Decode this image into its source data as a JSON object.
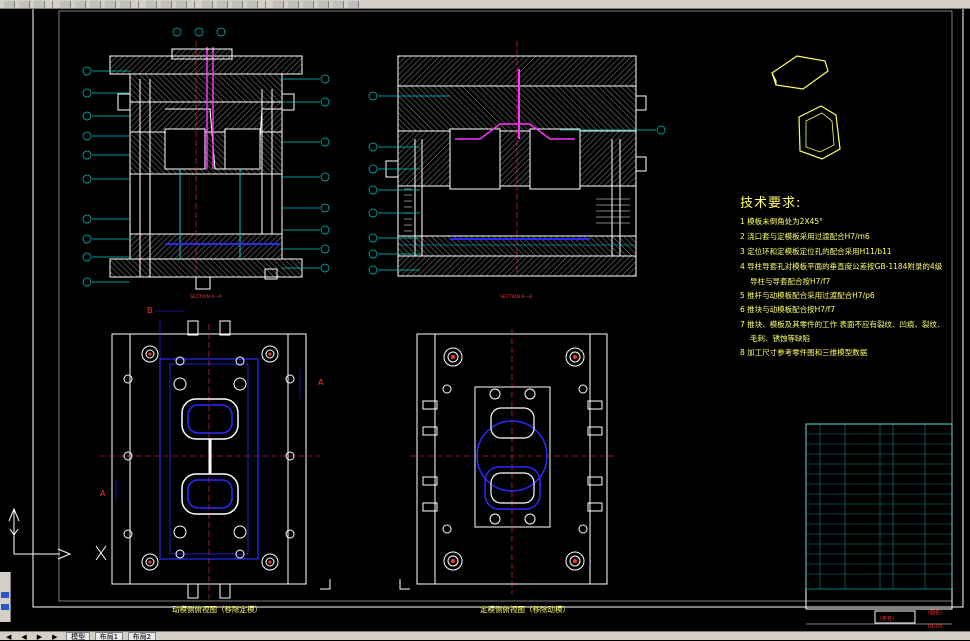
{
  "toolbar": {
    "buttons": [
      "new",
      "open",
      "save",
      "print",
      "preview",
      "cut",
      "copy",
      "paste",
      "match",
      "undo",
      "redo",
      "pan",
      "zoom-realtime",
      "zoom-window",
      "zoom-previous",
      "properties",
      "design-center",
      "tool-palettes",
      "markup",
      "calc",
      "help"
    ]
  },
  "drawing": {
    "section_aa_label": "SECTION A—A",
    "section_bb_label": "SECTION B—B",
    "left_plan_caption": "动模侧俯视图（移除定模）",
    "right_plan_caption": "定模侧俯视图（移除动模）",
    "cut_letter_a": "A",
    "cut_letter_b": "B"
  },
  "tech": {
    "title": "技术要求:",
    "items": [
      {
        "num": "1",
        "text": "模板未倒角处为2X45°"
      },
      {
        "num": "2",
        "text": "浇口套与定模板采用过渡配合H7/m6"
      },
      {
        "num": "3",
        "text": "定位环和定模板定位孔的配合采用H11/b11"
      },
      {
        "num": "4",
        "text": "导柱导套孔对模板平面的垂直度公差按GB-1184附录的4级"
      },
      {
        "num": "",
        "text": "导柱与导套配合按H7/f7"
      },
      {
        "num": "5",
        "text": "推杆与动模板配合采用过渡配合H7/p6"
      },
      {
        "num": "6",
        "text": "推块与动模板配合按H7/f7"
      },
      {
        "num": "7",
        "text": "推块、模板及其零件的工作 表面不应有裂纹、凹痕、裂纹、"
      },
      {
        "num": "",
        "text": "毛刺、锈蚀等缺陷"
      },
      {
        "num": "8",
        "text": "加工尺寸参考零件图和三维模型数据"
      }
    ]
  },
  "title_block": {
    "school_label": "(校名)",
    "drawing_label": "(图名)",
    "code_label": "01-00"
  },
  "tabs": {
    "nav": [
      "◀",
      "◀",
      "▶",
      "▶"
    ],
    "items": [
      "模型",
      "布局1",
      "布局2"
    ]
  },
  "colors": {
    "background": "#000000",
    "outline": "#ffffff",
    "hatch": "#cfcfcf",
    "accent_blue": "#2a2aff",
    "accent_cyan": "#00cccc",
    "accent_red": "#ff3333",
    "accent_magenta": "#ff33ff",
    "text_yellow": "#ffff66"
  }
}
